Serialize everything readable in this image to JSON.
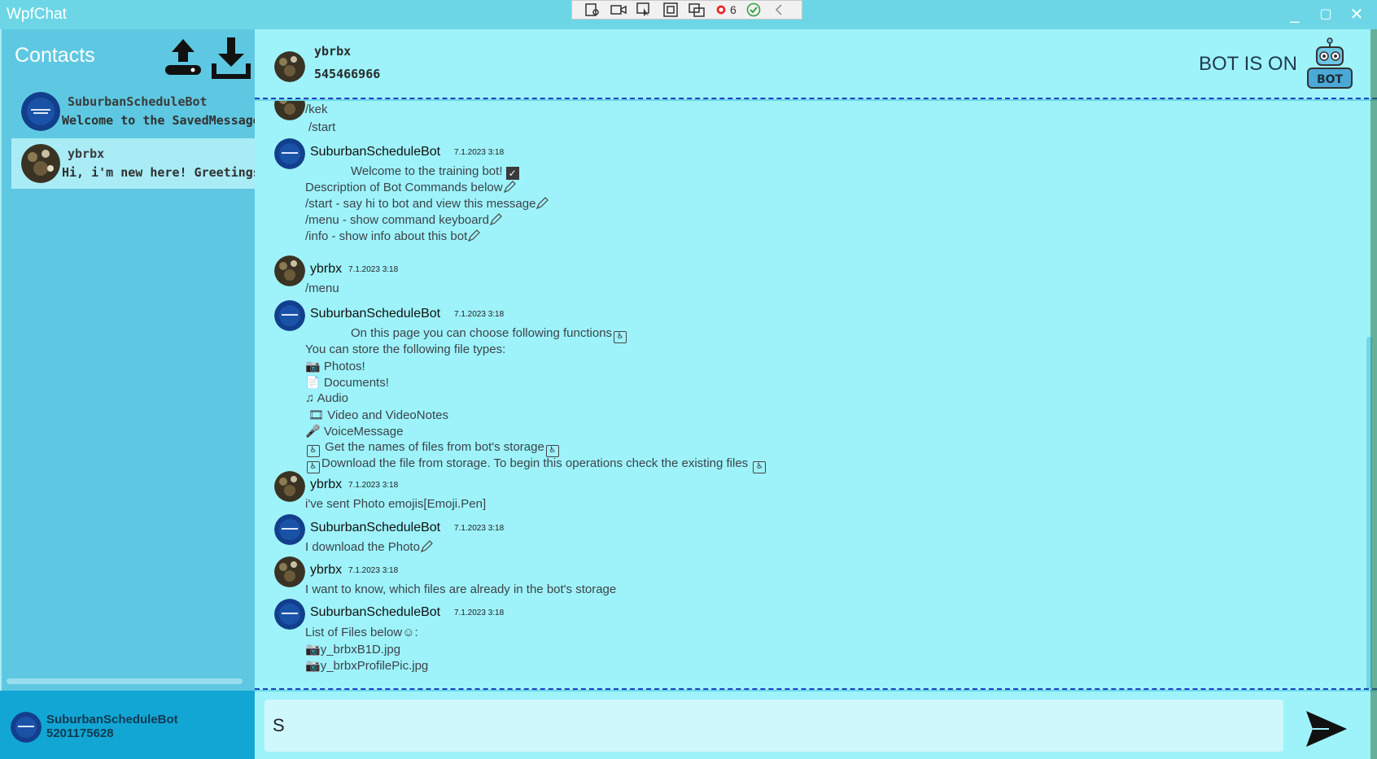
{
  "window": {
    "title": "WpfChat",
    "controls": {
      "minimize": "_",
      "maximize": "▢",
      "close": "✕"
    }
  },
  "debug_toolbar": {
    "items": [
      "select-element-icon",
      "record-icon",
      "pick-icon",
      "frame-icon",
      "track-focus-icon",
      "binding-errors-icon",
      "check-icon",
      "collapse-icon"
    ],
    "error_count": "6"
  },
  "sidebar": {
    "title": "Contacts",
    "actions": [
      "upload-icon",
      "download-icon"
    ],
    "contacts": [
      {
        "name": "SuburbanScheduleBot",
        "last_message": "Welcome to the SavedMessage",
        "avatar": "bot-avatar"
      },
      {
        "name": "ybrbx",
        "last_message": "Hi, i'm new here! Greetings",
        "avatar": "user-avatar",
        "selected": true
      }
    ]
  },
  "account": {
    "name": "SuburbanScheduleBot",
    "id": "5201175628"
  },
  "chat_header": {
    "name": "ybrbx",
    "id": "545466966",
    "bot_status": "BOT IS ON",
    "bot_icon": "robot-icon",
    "bot_icon_label": "BOT"
  },
  "messages": [
    {
      "lines": [
        "/kek",
        " /start"
      ],
      "partial": true
    },
    {
      "sender": "SuburbanScheduleBot",
      "time": "7.1.2023 3:18",
      "lines": [
        "Welcome to the training bot!",
        "Description of Bot Commands below",
        "/start - say hi to bot and view this message",
        "/menu - show command keyboard",
        "/info - show info about this bot"
      ]
    },
    {
      "sender": "ybrbx",
      "time": "7.1.2023 3:18",
      "lines": [
        "/menu"
      ]
    },
    {
      "sender": "SuburbanScheduleBot",
      "time": "7.1.2023 3:18",
      "lines": [
        "On this page you can choose following functions",
        "You can store the following file types:",
        "Photos!",
        "Documents!",
        "Audio",
        "Video and VideoNotes",
        "VoiceMessage",
        "Get the names of files from bot's storage",
        "Download the file from storage. To begin this operations check the existing files"
      ]
    },
    {
      "sender": "ybrbx",
      "time": "7.1.2023 3:18",
      "lines": [
        "i've sent Photo emojis[Emoji.Pen]"
      ]
    },
    {
      "sender": "SuburbanScheduleBot",
      "time": "7.1.2023 3:18",
      "lines": [
        "I download the Photo"
      ]
    },
    {
      "sender": "ybrbx",
      "time": "7.1.2023 3:18",
      "lines": [
        "I want to know, which files are already in the bot's storage"
      ]
    },
    {
      "sender": "SuburbanScheduleBot",
      "time": "7.1.2023 3:18",
      "lines": [
        "List of Files below",
        "y_brbxB1D.jpg",
        "y_brbxProfilePic.jpg"
      ]
    }
  ],
  "input": {
    "value": "S",
    "send_icon": "send-arrow-icon"
  },
  "colors": {
    "titlebar": "#6cd6e6",
    "sidebar": "#5ec8e2",
    "chat_bg": "#9ef3fb",
    "account_bg": "#12a6d4",
    "input_bg": "#cff8fd"
  }
}
